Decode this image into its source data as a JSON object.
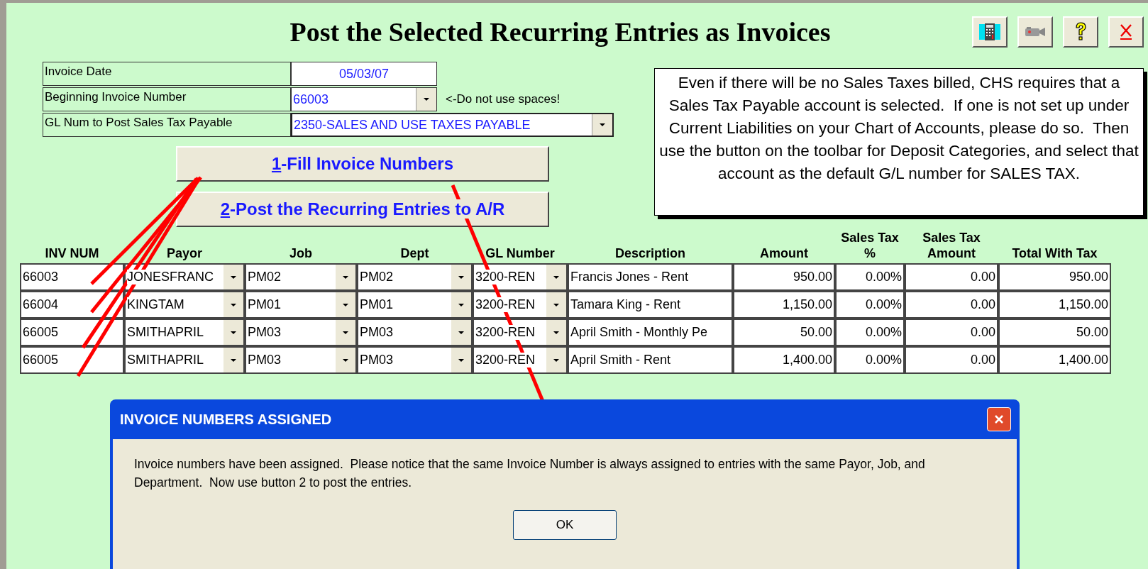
{
  "title": "Post the Selected Recurring Entries as Invoices",
  "toolbar": [
    {
      "kind": "calculator"
    },
    {
      "kind": "camera"
    },
    {
      "kind": "help"
    },
    {
      "kind": "close"
    }
  ],
  "form": [
    {
      "label": "Invoice Date",
      "value": "05/03/07",
      "kind": "date"
    },
    {
      "label": "Beginning Invoice Number",
      "value": "66003",
      "kind": "dropdown",
      "hint": "<-Do not use spaces!"
    },
    {
      "label": "GL Num to Post Sales Tax Payable",
      "value": "2350-SALES AND USE TAXES PAYABLE",
      "kind": "wide-dropdown"
    }
  ],
  "actions": [
    {
      "mnemonic": "1",
      "label": "-Fill Invoice Numbers"
    },
    {
      "mnemonic": "2",
      "label": "-Post the Recurring Entries to A/R"
    }
  ],
  "note": "Even if there will be no Sales Taxes billed, CHS requires that a Sales Tax Payable account is selected.  If one is not set up under Current Liabilities on your Chart of Accounts, please do so.  Then use the button on the toolbar for Deposit Categories, and select that account as the default G/L number for SALES TAX.",
  "table": {
    "columns": [
      {
        "header": "INV NUM",
        "kind": "text"
      },
      {
        "header": "Payor",
        "kind": "dropdown"
      },
      {
        "header": "Job",
        "kind": "dropdown"
      },
      {
        "header": "Dept",
        "kind": "dropdown"
      },
      {
        "header": "GL Number",
        "kind": "dropdown"
      },
      {
        "header": "Description",
        "kind": "text"
      },
      {
        "header": "Amount",
        "kind": "number"
      },
      {
        "header": "Sales Tax %",
        "kind": "number"
      },
      {
        "header": "Sales Tax Amount",
        "kind": "number"
      },
      {
        "header": "Total With Tax",
        "kind": "number"
      }
    ],
    "rows": [
      [
        "66003",
        "JONESFRANC",
        "PM02",
        "PM02",
        "3200-REN",
        "Francis Jones - Rent",
        "950.00",
        "0.00%",
        "0.00",
        "950.00"
      ],
      [
        "66004",
        "KINGTAM",
        "PM01",
        "PM01",
        "3200-REN",
        "Tamara King - Rent",
        "1,150.00",
        "0.00%",
        "0.00",
        "1,150.00"
      ],
      [
        "66005",
        "SMITHAPRIL",
        "PM03",
        "PM03",
        "3200-REN",
        "April Smith - Monthly Pe",
        "50.00",
        "0.00%",
        "0.00",
        "50.00"
      ],
      [
        "66005",
        "SMITHAPRIL",
        "PM03",
        "PM03",
        "3200-REN",
        "April Smith - Rent",
        "1,400.00",
        "0.00%",
        "0.00",
        "1,400.00"
      ]
    ]
  },
  "dialog": {
    "title": "INVOICE NUMBERS ASSIGNED",
    "message": "Invoice numbers have been assigned.  Please notice that the same Invoice Number is always assigned to entries with the same Payor, Job, and Department.  Now use button 2 to post the entries.",
    "button": "OK"
  }
}
